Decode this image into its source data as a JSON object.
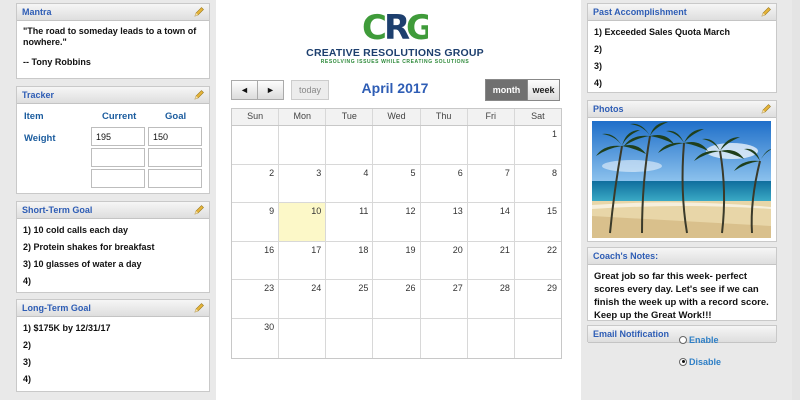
{
  "mantra": {
    "title": "Mantra",
    "quote": "\"The road to someday leads to a town of nowhere.\"",
    "author": "-- Tony Robbins"
  },
  "tracker": {
    "title": "Tracker",
    "col_item": "Item",
    "col_current": "Current",
    "col_goal": "Goal",
    "row_label": "Weight",
    "current_value": "195",
    "goal_value": "150"
  },
  "short_term_goal": {
    "title": "Short-Term Goal",
    "items": [
      "1) 10 cold calls each day",
      "2) Protein shakes for breakfast",
      "3) 10 glasses of water a day",
      "4)"
    ]
  },
  "long_term_goal": {
    "title": "Long-Term Goal",
    "items": [
      "1) $175K by 12/31/17",
      "2)",
      "3)",
      "4)"
    ]
  },
  "logo": {
    "letters": [
      "C",
      "R",
      "G"
    ],
    "name": "CREATIVE RESOLUTIONS GROUP",
    "tagline": "RESOLVING ISSUES WHILE CREATING SOLUTIONS",
    "colors": {
      "blue": "#1d3f6e",
      "green": "#3f9b3a"
    }
  },
  "calendar": {
    "prev_icon": "◄",
    "next_icon": "►",
    "today_label": "today",
    "title": "April 2017",
    "view_month": "month",
    "view_week": "week",
    "day_names": [
      "Sun",
      "Mon",
      "Tue",
      "Wed",
      "Thu",
      "Fri",
      "Sat"
    ],
    "weeks": [
      [
        "",
        "",
        "",
        "",
        "",
        "",
        "1"
      ],
      [
        "2",
        "3",
        "4",
        "5",
        "6",
        "7",
        "8"
      ],
      [
        "9",
        "10",
        "11",
        "12",
        "13",
        "14",
        "15"
      ],
      [
        "16",
        "17",
        "18",
        "19",
        "20",
        "21",
        "22"
      ],
      [
        "23",
        "24",
        "25",
        "26",
        "27",
        "28",
        "29"
      ],
      [
        "30",
        "",
        "",
        "",
        "",
        "",
        ""
      ]
    ],
    "today": "10",
    "today_color": "#fcf8c8"
  },
  "past_accomplishment": {
    "title": "Past Accomplishment",
    "items": [
      "1) Exceeded Sales Quota March",
      "2)",
      "3)",
      "4)"
    ]
  },
  "photos": {
    "title": "Photos"
  },
  "coach_notes": {
    "title": "Coach's Notes:",
    "text": "Great job so far this week- perfect scores every day. Let's see if we can finish the week up with a record score. Keep up the Great Work!!!"
  },
  "email_notification": {
    "title": "Email Notification",
    "options": [
      "Enable",
      "Disable"
    ],
    "selected": "Disable"
  },
  "accent_color": "#2e5db5"
}
